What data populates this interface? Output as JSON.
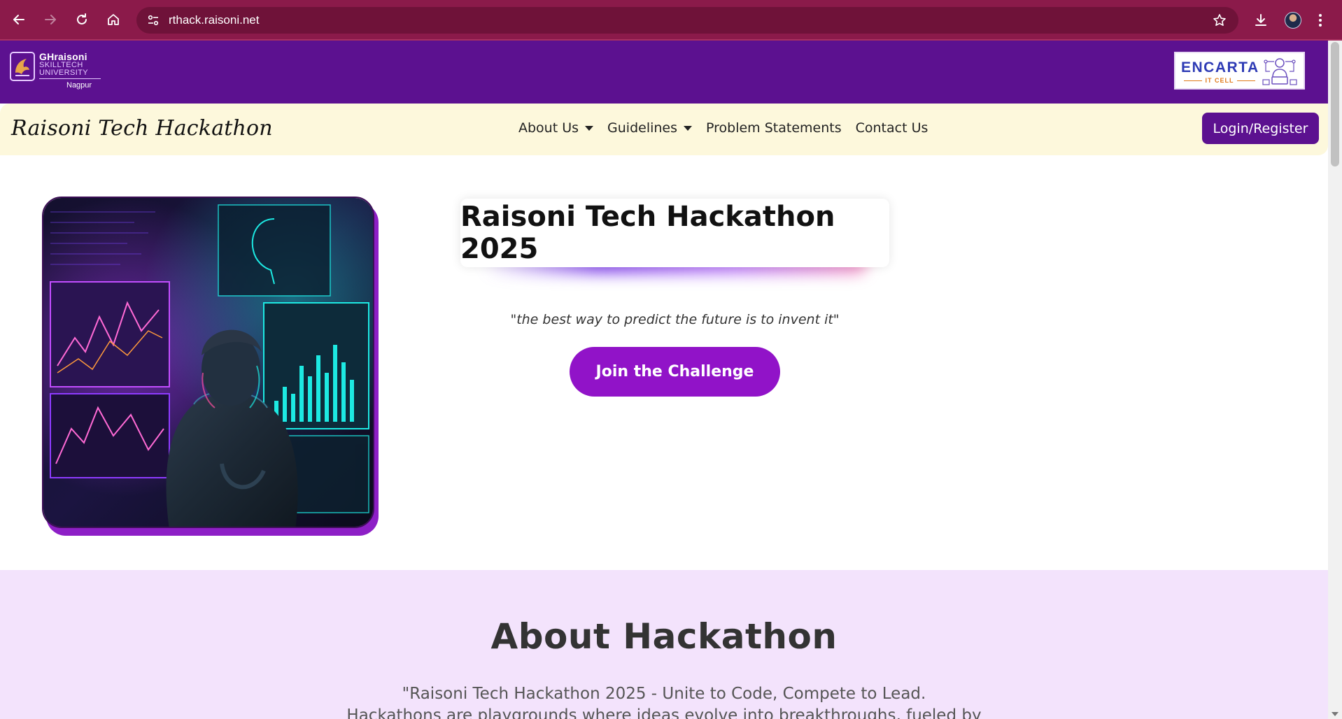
{
  "browser": {
    "url": "rthack.raisoni.net"
  },
  "header": {
    "university_logo": {
      "line1": "GHraisoni",
      "line2": "SKILLTECH",
      "line3": "UNIVERSITY",
      "line4": "Nagpur"
    },
    "partner_logo": {
      "name": "ENCARTA",
      "subtitle": "IT CELL"
    }
  },
  "navbar": {
    "brand": "Raisoni Tech Hackathon",
    "links": [
      {
        "label": "About Us",
        "dropdown": true
      },
      {
        "label": "Guidelines",
        "dropdown": true
      },
      {
        "label": "Problem Statements",
        "dropdown": false
      },
      {
        "label": "Contact Us",
        "dropdown": false
      }
    ],
    "login_label": "Login/Register"
  },
  "hero": {
    "title": "Raisoni Tech Hackathon 2025",
    "quote": "\"the best way to predict the future is to invent it\"",
    "cta_label": "Join the Challenge"
  },
  "about": {
    "title": "About Hackathon",
    "line1": "\"Raisoni Tech Hackathon 2025 - Unite to Code, Compete to Lead.",
    "line2": "Hackathons are playgrounds where ideas evolve into breakthroughs, fueled by"
  },
  "colors": {
    "browser_frame": "#8b1a4a",
    "header_purple": "#5c1190",
    "navbar_cream": "#fdf8dc",
    "accent_purple": "#9113c8",
    "about_bg": "#f3e3fc"
  }
}
